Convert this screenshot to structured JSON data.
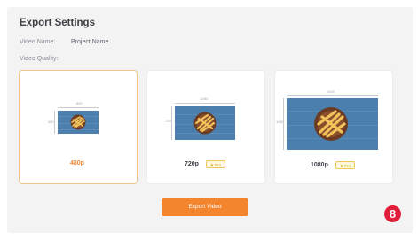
{
  "header": {
    "title": "Export Settings"
  },
  "fields": {
    "video_name_label": "Video Name:",
    "video_name_value": "Project Name",
    "video_quality_label": "Video Quality:"
  },
  "quality_options": [
    {
      "resolution": "480p",
      "width_label": "852",
      "height_label": "480",
      "selected": true,
      "badge": ""
    },
    {
      "resolution": "720p",
      "width_label": "1280",
      "height_label": "720",
      "selected": false,
      "badge": "Pro"
    },
    {
      "resolution": "1080p",
      "width_label": "1920",
      "height_label": "1080",
      "selected": false,
      "badge": "Pro"
    }
  ],
  "actions": {
    "export_label": "Export Video"
  },
  "step_badge": "8",
  "colors": {
    "accent": "#f3852f",
    "preview_background": "#4a7fae",
    "step_badge": "#e31e3b",
    "pro_badge": "#d29b14"
  },
  "icons": {
    "badge_icon": "crown-icon",
    "thumbnail": "fries-bowl-image"
  }
}
